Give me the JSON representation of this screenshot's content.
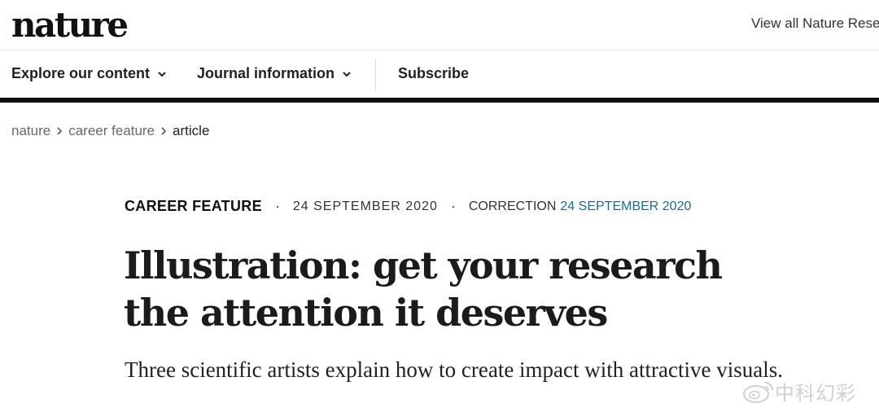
{
  "header": {
    "logo": "nature",
    "view_all": "View all Nature Rese"
  },
  "nav": {
    "items": [
      {
        "label": "Explore our content",
        "dropdown": true
      },
      {
        "label": "Journal information",
        "dropdown": true
      },
      {
        "label": "Subscribe",
        "dropdown": false
      }
    ]
  },
  "breadcrumb": {
    "items": [
      "nature",
      "career feature",
      "article"
    ]
  },
  "article": {
    "type": "CAREER FEATURE",
    "date": "24 SEPTEMBER 2020",
    "correction_label": "CORRECTION",
    "correction_date": "24 SEPTEMBER 2020",
    "title": "Illustration: get your research the attention it deserves",
    "standfirst": "Three scientific artists explain how to create impact with attractive visuals."
  },
  "watermark": {
    "text": "中科幻彩"
  },
  "colors": {
    "link": "#1a6b96",
    "rule": "#111111"
  }
}
